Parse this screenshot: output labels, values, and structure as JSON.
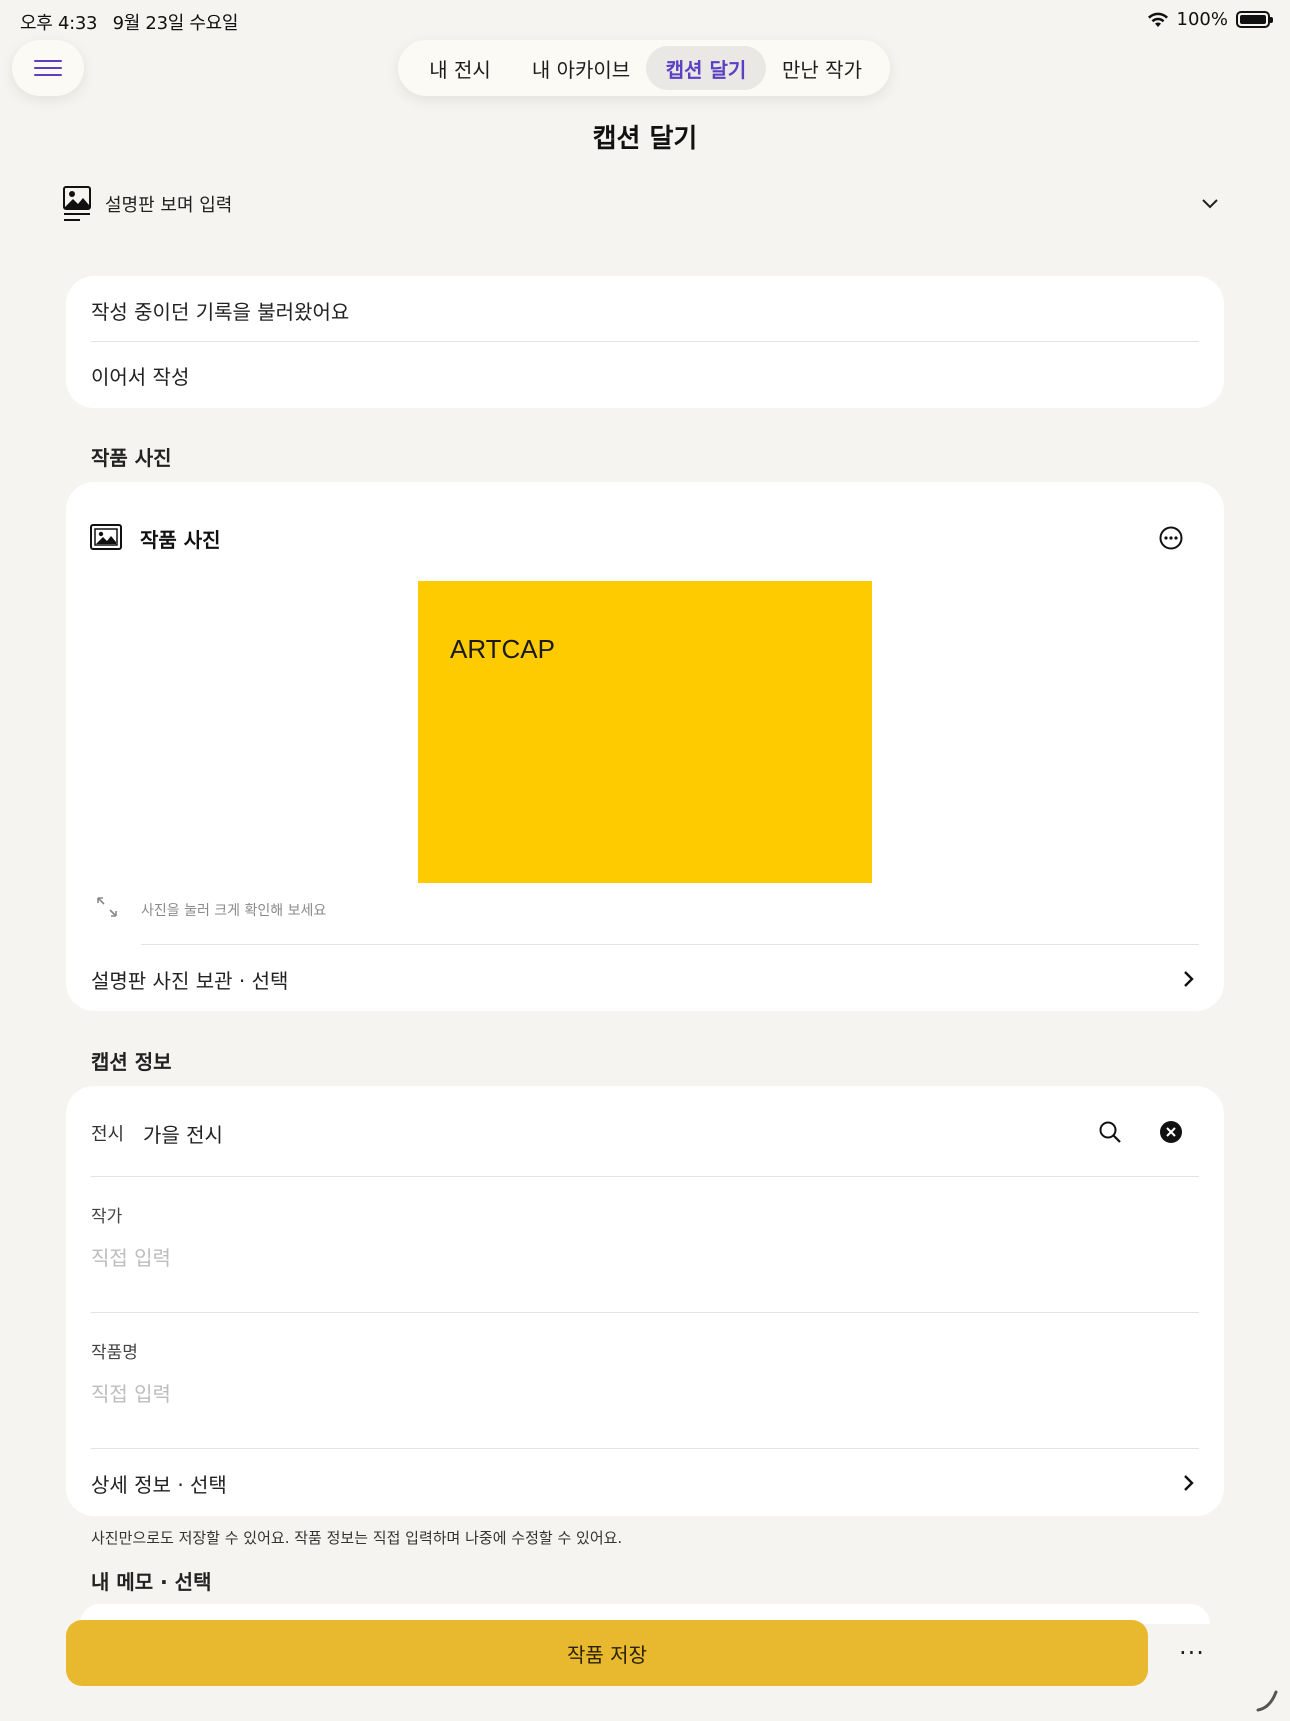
{
  "status_bar": {
    "time": "오후 4:33",
    "date": "9월 23일 수요일",
    "battery": "100%"
  },
  "nav": {
    "tabs": [
      {
        "label": "내 전시"
      },
      {
        "label": "내 아카이브"
      },
      {
        "label": "캡션 달기",
        "active": true
      },
      {
        "label": "만난 작가"
      }
    ]
  },
  "page": {
    "title": "캡션 달기"
  },
  "guide": {
    "label": "설명판 보며 입력"
  },
  "draft": {
    "title": "작성 중이던 기록을 불러왔어요",
    "action": "이어서 작성"
  },
  "photo_section": {
    "label": "작품 사진",
    "card_title": "작품 사진",
    "artwork_text": "ARTCAP",
    "artwork_color": "#fecb00",
    "hint": "사진을 눌러 크게 확인해 보세요",
    "placard_action": "설명판 사진 보관 · 선택"
  },
  "caption_section": {
    "label": "캡션 정보",
    "exhibition_key": "전시",
    "exhibition_value": "가을 전시",
    "artist_label": "작가",
    "artist_placeholder": "직접 입력",
    "title_label": "작품명",
    "title_placeholder": "직접 입력",
    "detail_action": "상세 정보 · 선택"
  },
  "note": "사진만으로도 저장할 수 있어요. 작품 정보는 직접 입력하며 나중에 수정할 수 있어요.",
  "memo_section": {
    "label": "내 메모 · 선택"
  },
  "footer": {
    "save_label": "작품 저장",
    "more_label": "···",
    "accent": "#e8b92e"
  },
  "colors": {
    "background": "#f5f4f0",
    "active_tab": "#5b3fc4"
  }
}
